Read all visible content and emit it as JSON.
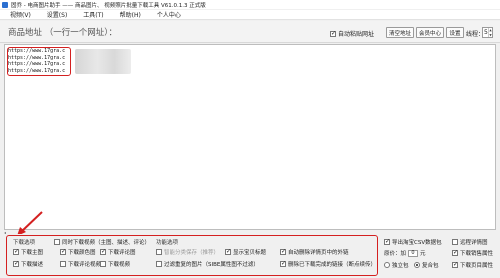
{
  "window": {
    "title": "固乔 - 电商图片助手 —— 商品图片、 视频照片批量下载工具 V61.0.1.3 正式版"
  },
  "menu": [
    "视频(V)",
    "设置(S)",
    "工具(T)",
    "帮助(H)",
    "个人中心"
  ],
  "toolbar": {
    "url_heading": "商品地址 （一行一个网址）：",
    "auto_paste_label": "自动粘贴网址",
    "auto_paste_checked": true,
    "clear_label": "清空地址",
    "member_label": "会员中心",
    "settings_label": "设置",
    "threads_label": "线程：",
    "threads_value": "5"
  },
  "url_list": [
    "https://www.17gra.c",
    "https://www.17gra.c",
    "https://www.17gra.c",
    "https://www.17gra.c"
  ],
  "options": {
    "download_group_label": "下载选项",
    "function_group_label": "功能选项",
    "download": [
      {
        "label": "下载主图",
        "checked": true
      },
      {
        "label": "同时下载视频（主图、描述、评论）",
        "checked": false
      },
      {
        "label": "下载颜色图",
        "checked": true
      },
      {
        "label": "下载评论图",
        "checked": true
      },
      {
        "label": "下载描述",
        "checked": true
      },
      {
        "label": "下载评论视频",
        "checked": false
      }
    ],
    "download_row2": [
      {
        "label": "下载视频",
        "checked": false
      },
      {
        "label": "下载评论图",
        "checked": false
      }
    ],
    "function": [
      {
        "label": "智能分类保存（推荐）",
        "checked": false,
        "disabled": true
      },
      {
        "label": "显示宝贝标题",
        "checked": true
      },
      {
        "label": "自动删除详情页中的外链",
        "checked": true
      },
      {
        "label": "过滤重复的图片（SIBE属性图不过滤）",
        "checked": false
      },
      {
        "label": "删除已下载完成的链接（断点续传）",
        "checked": true
      }
    ]
  },
  "right_panel": {
    "export_csv": {
      "label": "导出淘宝CSV数据包",
      "checked": true
    },
    "remote_detail": {
      "label": "远程详情图",
      "checked": false
    },
    "price_label": "原价：加",
    "price_value": "0",
    "price_unit": "元",
    "price_attr": {
      "label": "下载销售属性",
      "checked": true
    },
    "bag_label": "独立包",
    "merge_label": "复合包",
    "merge_selected": true,
    "download_selected": {
      "label": "下载页目属性",
      "checked": true
    }
  },
  "colors": {
    "highlight": "#d42020",
    "accent": "#2b6fd0"
  }
}
